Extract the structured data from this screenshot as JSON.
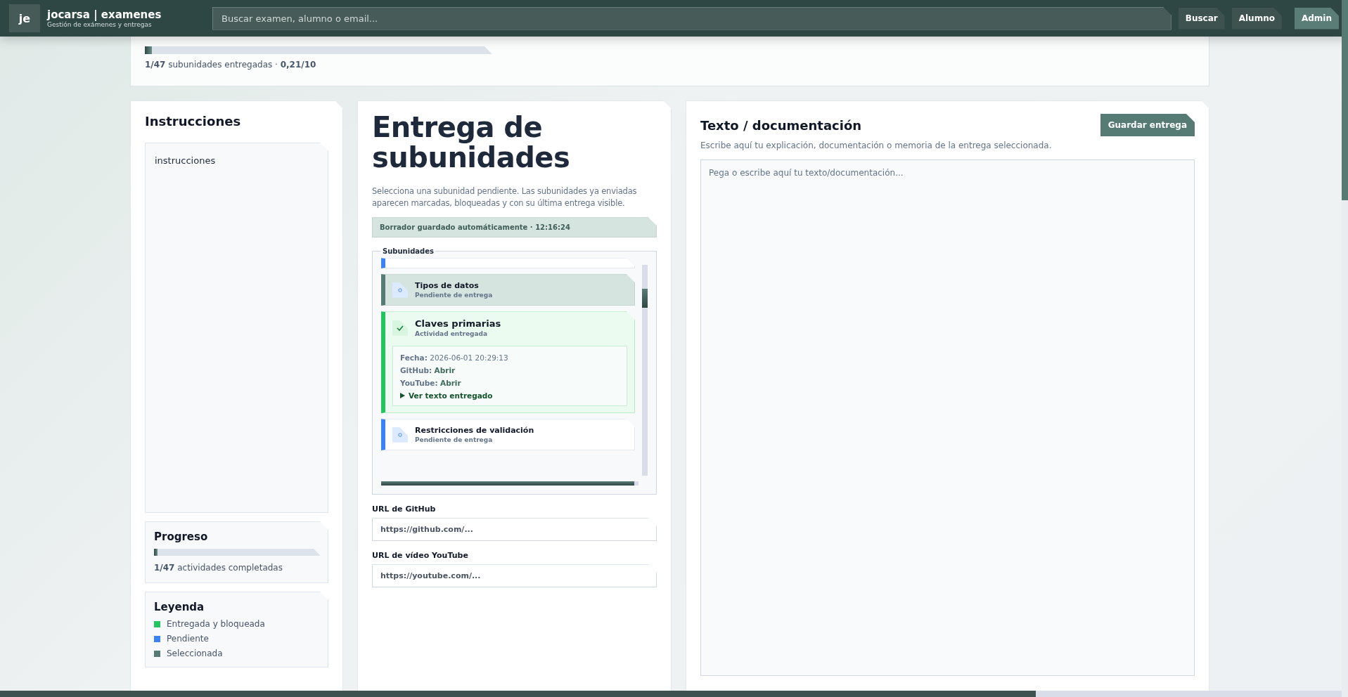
{
  "header": {
    "logo": "je",
    "title": "jocarsa | examenes",
    "subtitle": "Gestión de exámenes y entregas",
    "search": {
      "placeholder": "Buscar examen, alumno o email..."
    },
    "buttons": [
      {
        "label": "Buscar",
        "selected": false
      },
      {
        "label": "Alumno",
        "selected": false
      },
      {
        "label": "Admin",
        "selected": true
      }
    ]
  },
  "summary": {
    "level": 0.02,
    "text": "**1/47** subunidades entregadas · **0,21/10**"
  },
  "instructions": {
    "title": "Instrucciones",
    "text": "instrucciones"
  },
  "progress": {
    "title": "Progreso",
    "level": 0.02,
    "text": "**1/47** actividades completadas"
  },
  "legend": {
    "title": "Leyenda",
    "items": [
      {
        "label": "Entregada y bloqueada",
        "color": "#22c55e"
      },
      {
        "label": "Pendiente",
        "color": "#3b82f6"
      },
      {
        "label": "Seleccionada",
        "color": "#557b74"
      }
    ]
  },
  "main": {
    "title": "Entrega de subunidades",
    "description": "Selecciona una subunidad pendiente. Las subunidades ya enviadas aparecen marcadas, bloqueadas y con su última entrega visible.",
    "autosave": "Borrador guardado automáticamente · 12:16:24",
    "subunits": {
      "legend": "Subunidades",
      "items": [
        {
          "kind": "pending",
          "selected": false
        },
        {
          "kind": "pending",
          "selected": true,
          "title": "Tipos de datos",
          "status": "Pendiente de entrega"
        },
        {
          "kind": "delivered",
          "selected": false,
          "title": "Claves primarias",
          "status": "Actividad entregada",
          "details": [
            {
              "kind": "text",
              "label": "Fecha:",
              "value": "2026-06-01 20:29:13"
            },
            {
              "kind": "link",
              "label": "GitHub:",
              "value": "Abrir"
            },
            {
              "kind": "link",
              "label": "YouTube:",
              "value": "Abrir"
            }
          ],
          "toggle": {
            "label": "Ver texto entregado",
            "expanded": false
          }
        },
        {
          "kind": "pending",
          "selected": false,
          "title": "Restricciones de validación",
          "status": "Pendiente de entrega"
        }
      ]
    },
    "fields": [
      {
        "label": "URL de GitHub",
        "placeholder": "https://github.com/..."
      },
      {
        "label": "URL de vídeo YouTube",
        "placeholder": "https://youtube.com/..."
      }
    ]
  },
  "editor": {
    "title": "Texto / documentación",
    "button": "Guardar entrega",
    "description": "Escribe aquí tu explicación, documentación o memoria de la entrega seleccionada.",
    "placeholder": "Pega o escribe aquí tu texto/documentación..."
  }
}
